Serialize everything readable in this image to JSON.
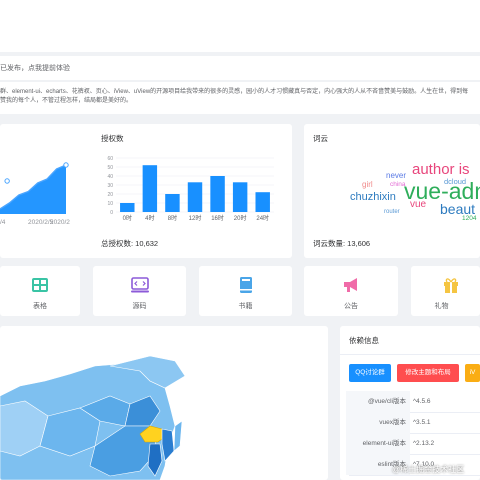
{
  "notice": {
    "text": "已发布，点我提前体验"
  },
  "intro": {
    "line1": "群、element-ui、echarts、花裤衩、页心、iView、uView的开源项目给我带来的很多的灵感，园小的人才习惯藏真与否定，内心强大的人从不吝啬赞美与鼓励。人生在世，得到每",
    "line2": "赞我的每个人，不管过程怎样，结局都是美好的。"
  },
  "line_card": {
    "x_labels": [
      "/4",
      "2020/2/5",
      "2020/2"
    ],
    "values": [
      10,
      22,
      38,
      45,
      62,
      70,
      90,
      98
    ]
  },
  "bar_card": {
    "title": "授权数",
    "footer": "总授权数: 10,632",
    "chart_data": {
      "type": "bar",
      "categories": [
        "0时",
        "4时",
        "8时",
        "12时",
        "16时",
        "20时",
        "24时"
      ],
      "values": [
        10,
        52,
        20,
        33,
        40,
        33,
        22
      ],
      "ylim": [
        0,
        60
      ],
      "y_ticks": [
        "0",
        "10",
        "20",
        "30",
        "40",
        "50",
        "60"
      ],
      "color": "#1890ff"
    }
  },
  "cloud_card": {
    "title": "词云",
    "footer": "词云数量: 13,606",
    "words": [
      {
        "text": "author is",
        "color": "#e8467c"
      },
      {
        "text": "never",
        "color": "#5b7be5"
      },
      {
        "text": "china",
        "color": "#e36bd4"
      },
      {
        "text": "girl",
        "color": "#f08a8a"
      },
      {
        "text": "vue-adm",
        "color": "#2fae5b"
      },
      {
        "text": "chuzhixin",
        "color": "#2d7bbf"
      },
      {
        "text": "dcloud",
        "color": "#5b9ad5"
      },
      {
        "text": "vue",
        "color": "#e8467c"
      },
      {
        "text": "beaut",
        "color": "#2d7bbf"
      },
      {
        "text": "router",
        "color": "#5b9ad5"
      },
      {
        "text": "1204",
        "color": "#2fae5b"
      }
    ]
  },
  "quick": [
    {
      "label": "表格",
      "icon": "table-icon",
      "color": "#3ac4a5"
    },
    {
      "label": "源码",
      "icon": "code-icon",
      "color": "#8c5ad8"
    },
    {
      "label": "书籍",
      "icon": "book-icon",
      "color": "#4aa5e8"
    },
    {
      "label": "公告",
      "icon": "megaphone-icon",
      "color": "#f06ba8"
    },
    {
      "label": "礼物",
      "icon": "gift-icon",
      "color": "#f5c542"
    }
  ],
  "deps": {
    "title": "依赖信息",
    "buttons": [
      {
        "label": "QQ讨论群",
        "color": "#1890ff"
      },
      {
        "label": "修改主题和布局",
        "color": "#ff4d4f"
      },
      {
        "label": "iV",
        "color": "#faad14"
      }
    ],
    "rows": [
      {
        "name": "@vue/cli版本",
        "version": "^4.5.6"
      },
      {
        "name": "vuex版本",
        "version": "^3.5.1"
      },
      {
        "name": "element-ui版本",
        "version": "^2.13.2"
      },
      {
        "name": "eslint版本",
        "version": "^7.10.0"
      }
    ]
  },
  "watermark": {
    "text": "@稀土掘金技术社区"
  }
}
